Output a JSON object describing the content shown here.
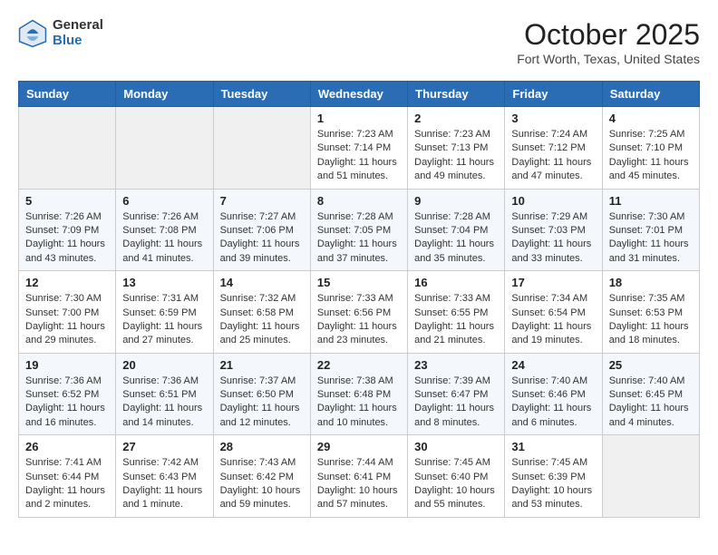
{
  "header": {
    "logo_general": "General",
    "logo_blue": "Blue",
    "month_title": "October 2025",
    "location": "Fort Worth, Texas, United States"
  },
  "days_of_week": [
    "Sunday",
    "Monday",
    "Tuesday",
    "Wednesday",
    "Thursday",
    "Friday",
    "Saturday"
  ],
  "weeks": [
    [
      {
        "day": "",
        "empty": true
      },
      {
        "day": "",
        "empty": true
      },
      {
        "day": "",
        "empty": true
      },
      {
        "day": "1",
        "sunrise": "7:23 AM",
        "sunset": "7:14 PM",
        "daylight": "11 hours and 51 minutes."
      },
      {
        "day": "2",
        "sunrise": "7:23 AM",
        "sunset": "7:13 PM",
        "daylight": "11 hours and 49 minutes."
      },
      {
        "day": "3",
        "sunrise": "7:24 AM",
        "sunset": "7:12 PM",
        "daylight": "11 hours and 47 minutes."
      },
      {
        "day": "4",
        "sunrise": "7:25 AM",
        "sunset": "7:10 PM",
        "daylight": "11 hours and 45 minutes."
      }
    ],
    [
      {
        "day": "5",
        "sunrise": "7:26 AM",
        "sunset": "7:09 PM",
        "daylight": "11 hours and 43 minutes."
      },
      {
        "day": "6",
        "sunrise": "7:26 AM",
        "sunset": "7:08 PM",
        "daylight": "11 hours and 41 minutes."
      },
      {
        "day": "7",
        "sunrise": "7:27 AM",
        "sunset": "7:06 PM",
        "daylight": "11 hours and 39 minutes."
      },
      {
        "day": "8",
        "sunrise": "7:28 AM",
        "sunset": "7:05 PM",
        "daylight": "11 hours and 37 minutes."
      },
      {
        "day": "9",
        "sunrise": "7:28 AM",
        "sunset": "7:04 PM",
        "daylight": "11 hours and 35 minutes."
      },
      {
        "day": "10",
        "sunrise": "7:29 AM",
        "sunset": "7:03 PM",
        "daylight": "11 hours and 33 minutes."
      },
      {
        "day": "11",
        "sunrise": "7:30 AM",
        "sunset": "7:01 PM",
        "daylight": "11 hours and 31 minutes."
      }
    ],
    [
      {
        "day": "12",
        "sunrise": "7:30 AM",
        "sunset": "7:00 PM",
        "daylight": "11 hours and 29 minutes."
      },
      {
        "day": "13",
        "sunrise": "7:31 AM",
        "sunset": "6:59 PM",
        "daylight": "11 hours and 27 minutes."
      },
      {
        "day": "14",
        "sunrise": "7:32 AM",
        "sunset": "6:58 PM",
        "daylight": "11 hours and 25 minutes."
      },
      {
        "day": "15",
        "sunrise": "7:33 AM",
        "sunset": "6:56 PM",
        "daylight": "11 hours and 23 minutes."
      },
      {
        "day": "16",
        "sunrise": "7:33 AM",
        "sunset": "6:55 PM",
        "daylight": "11 hours and 21 minutes."
      },
      {
        "day": "17",
        "sunrise": "7:34 AM",
        "sunset": "6:54 PM",
        "daylight": "11 hours and 19 minutes."
      },
      {
        "day": "18",
        "sunrise": "7:35 AM",
        "sunset": "6:53 PM",
        "daylight": "11 hours and 18 minutes."
      }
    ],
    [
      {
        "day": "19",
        "sunrise": "7:36 AM",
        "sunset": "6:52 PM",
        "daylight": "11 hours and 16 minutes."
      },
      {
        "day": "20",
        "sunrise": "7:36 AM",
        "sunset": "6:51 PM",
        "daylight": "11 hours and 14 minutes."
      },
      {
        "day": "21",
        "sunrise": "7:37 AM",
        "sunset": "6:50 PM",
        "daylight": "11 hours and 12 minutes."
      },
      {
        "day": "22",
        "sunrise": "7:38 AM",
        "sunset": "6:48 PM",
        "daylight": "11 hours and 10 minutes."
      },
      {
        "day": "23",
        "sunrise": "7:39 AM",
        "sunset": "6:47 PM",
        "daylight": "11 hours and 8 minutes."
      },
      {
        "day": "24",
        "sunrise": "7:40 AM",
        "sunset": "6:46 PM",
        "daylight": "11 hours and 6 minutes."
      },
      {
        "day": "25",
        "sunrise": "7:40 AM",
        "sunset": "6:45 PM",
        "daylight": "11 hours and 4 minutes."
      }
    ],
    [
      {
        "day": "26",
        "sunrise": "7:41 AM",
        "sunset": "6:44 PM",
        "daylight": "11 hours and 2 minutes."
      },
      {
        "day": "27",
        "sunrise": "7:42 AM",
        "sunset": "6:43 PM",
        "daylight": "11 hours and 1 minute."
      },
      {
        "day": "28",
        "sunrise": "7:43 AM",
        "sunset": "6:42 PM",
        "daylight": "10 hours and 59 minutes."
      },
      {
        "day": "29",
        "sunrise": "7:44 AM",
        "sunset": "6:41 PM",
        "daylight": "10 hours and 57 minutes."
      },
      {
        "day": "30",
        "sunrise": "7:45 AM",
        "sunset": "6:40 PM",
        "daylight": "10 hours and 55 minutes."
      },
      {
        "day": "31",
        "sunrise": "7:45 AM",
        "sunset": "6:39 PM",
        "daylight": "10 hours and 53 minutes."
      },
      {
        "day": "",
        "empty": true
      }
    ]
  ],
  "labels": {
    "sunrise": "Sunrise:",
    "sunset": "Sunset:",
    "daylight": "Daylight:"
  }
}
